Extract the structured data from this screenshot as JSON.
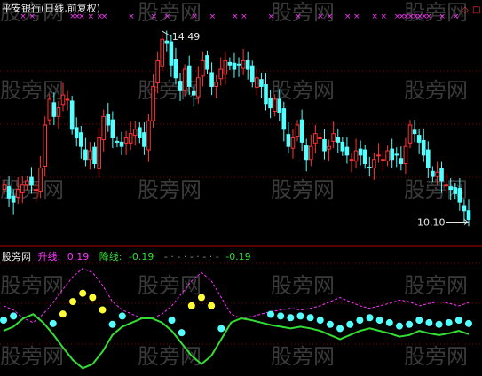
{
  "header": {
    "title": "平安银行(日线,前复权)"
  },
  "indicator_legend": {
    "name": "股旁网",
    "up_label": "升线:",
    "up_value": "0.19",
    "down_label": "降线:",
    "down_value": "-0.19",
    "placeholder": "- · - · - · - · -",
    "last_value": "-0.19"
  },
  "watermark_text": "股旁网",
  "colors": {
    "background": "#000000",
    "up_candle": "#ff3333",
    "down_candle": "#54ffff",
    "marker_x": "#ff33ff",
    "up_line": "#ff33ff",
    "down_line": "#33dd33",
    "dots_high": "#ffff33",
    "dots_low": "#54ffff",
    "grid": "#8b0000"
  },
  "chart_data": [
    {
      "type": "candlestick",
      "title": "平安银行(日线,前复权)",
      "annotations": [
        {
          "label": "14.49",
          "kind": "high"
        },
        {
          "label": "10.10",
          "kind": "low"
        }
      ],
      "y_range": [
        9.8,
        14.8
      ],
      "close": [
        10.9,
        10.6,
        10.5,
        10.8,
        10.9,
        11.0,
        10.9,
        10.8,
        11.3,
        12.3,
        12.9,
        12.5,
        12.7,
        13.0,
        12.9,
        12.2,
        12.0,
        11.8,
        11.5,
        11.7,
        11.4,
        12.0,
        12.5,
        12.3,
        12.0,
        11.9,
        11.8,
        12.0,
        12.1,
        12.2,
        12.0,
        11.8,
        12.4,
        13.2,
        13.8,
        14.3,
        14.2,
        13.7,
        13.4,
        13.1,
        13.6,
        13.2,
        13.0,
        13.4,
        13.8,
        13.6,
        13.2,
        13.3,
        13.6,
        13.8,
        13.7,
        13.6,
        13.7,
        13.8,
        13.6,
        13.3,
        13.4,
        13.2,
        12.8,
        12.7,
        12.9,
        12.6,
        12.2,
        11.8,
        12.0,
        12.3,
        11.9,
        11.5,
        11.8,
        12.1,
        12.0,
        11.7,
        11.8,
        12.1,
        11.9,
        11.7,
        11.6,
        11.5,
        11.7,
        11.6,
        11.4,
        11.3,
        11.5,
        11.6,
        11.5,
        11.7,
        11.5,
        11.6,
        11.4,
        11.8,
        12.3,
        12.1,
        11.9,
        11.6,
        11.3,
        11.1,
        11.2,
        11.0,
        10.9,
        10.8,
        10.7,
        10.5,
        10.3,
        10.1
      ],
      "volume_markers": "x marks above bars"
    },
    {
      "type": "line",
      "series": [
        {
          "name": "升线",
          "values": [
            0.15,
            0.1,
            0.0,
            -0.05,
            0.05,
            0.19,
            0.35,
            0.5,
            0.6,
            0.55,
            0.4,
            0.2,
            0.1,
            0.05,
            0.0,
            0.0,
            0.05,
            0.15,
            0.3,
            0.45,
            0.55,
            0.45,
            0.25,
            0.05,
            0.0,
            0.02,
            0.05,
            0.08,
            0.1,
            0.12,
            0.1,
            0.12,
            0.15,
            0.2,
            0.25,
            0.2,
            0.15,
            0.12,
            0.15,
            0.18,
            0.22,
            0.2,
            0.15,
            0.18,
            0.2,
            0.18,
            0.15,
            0.19
          ]
        },
        {
          "name": "降线",
          "values": [
            -0.15,
            -0.1,
            0.0,
            0.05,
            -0.05,
            -0.19,
            -0.35,
            -0.5,
            -0.6,
            -0.55,
            -0.4,
            -0.2,
            -0.1,
            -0.05,
            0.0,
            0.0,
            -0.05,
            -0.15,
            -0.3,
            -0.45,
            -0.55,
            -0.45,
            -0.25,
            -0.05,
            0.0,
            -0.02,
            -0.05,
            -0.08,
            -0.1,
            -0.12,
            -0.1,
            -0.12,
            -0.15,
            -0.2,
            -0.25,
            -0.2,
            -0.15,
            -0.12,
            -0.15,
            -0.18,
            -0.22,
            -0.2,
            -0.15,
            -0.18,
            -0.2,
            -0.18,
            -0.15,
            -0.19
          ]
        }
      ]
    }
  ]
}
